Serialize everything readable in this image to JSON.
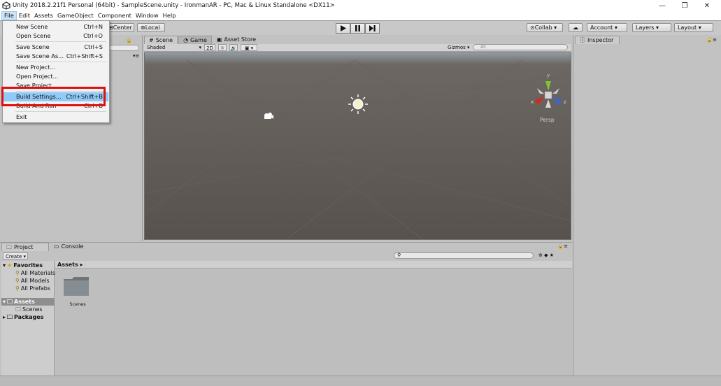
{
  "window": {
    "title": "Unity 2018.2.21f1 Personal (64bit) - SampleScene.unity - IronmanAR - PC, Mac & Linux Standalone <DX11>",
    "minimize": "—",
    "maximize": "❐",
    "close": "✕"
  },
  "menubar": {
    "items": [
      "File",
      "Edit",
      "Assets",
      "GameObject",
      "Component",
      "Window",
      "Help"
    ],
    "active": "File"
  },
  "file_menu": {
    "items": [
      {
        "label": "New Scene",
        "shortcut": "Ctrl+N"
      },
      {
        "label": "Open Scene",
        "shortcut": "Ctrl+O"
      },
      {
        "label": "Save Scene",
        "shortcut": "Ctrl+S"
      },
      {
        "label": "Save Scene As...",
        "shortcut": "Ctrl+Shift+S"
      },
      {
        "label": "New Project...",
        "shortcut": ""
      },
      {
        "label": "Open Project...",
        "shortcut": ""
      },
      {
        "label": "Save Project",
        "shortcut": ""
      },
      {
        "label": "Build Settings...",
        "shortcut": "Ctrl+Shift+B"
      },
      {
        "label": "Build And Run",
        "shortcut": "Ctrl+B"
      },
      {
        "label": "Exit",
        "shortcut": ""
      }
    ],
    "highlighted": "Build Settings..."
  },
  "toolbar": {
    "center_label": "Center",
    "local_label": "Local",
    "collab_label": "Collab",
    "account_label": "Account",
    "layers_label": "Layers",
    "layout_label": "Layout"
  },
  "scene": {
    "tabs": [
      "Scene",
      "Game",
      "Asset Store"
    ],
    "active_tab": "Scene",
    "shading_mode": "Shaded",
    "toggle_2d": "2D",
    "gizmos_label": "Gizmos",
    "search_placeholder": "All",
    "persp_label": "Persp",
    "axis_labels": {
      "x": "x",
      "y": "y",
      "z": "z"
    }
  },
  "inspector": {
    "tab_label": "Inspector"
  },
  "project": {
    "tabs": [
      "Project",
      "Console"
    ],
    "create_label": "Create",
    "favorites_label": "Favorites",
    "favorites": [
      "All Materials",
      "All Models",
      "All Prefabs"
    ],
    "assets_label": "Assets",
    "assets_children": [
      "Scenes"
    ],
    "packages_label": "Packages",
    "breadcrumb": "Assets",
    "grid_items": [
      "Scenes"
    ]
  },
  "colors": {
    "highlight_box": "#e01010",
    "menu_hover": "#91c9f7",
    "scene_bg": "#5c5752"
  }
}
